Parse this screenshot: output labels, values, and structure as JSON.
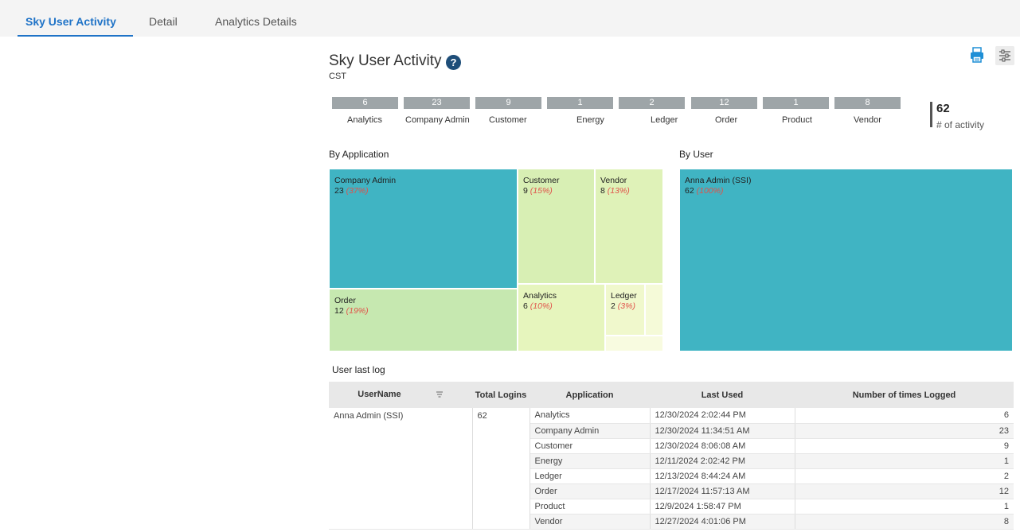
{
  "tabs": [
    {
      "label": "Sky User Activity",
      "active": true
    },
    {
      "label": "Detail",
      "active": false
    },
    {
      "label": "Analytics Details",
      "active": false
    }
  ],
  "page": {
    "title": "Sky User Activity",
    "help": "?",
    "subtitle": "CST"
  },
  "tools": {
    "print_icon": "printer-icon",
    "settings_icon": "sliders-icon"
  },
  "colors": {
    "accent": "#1f73c7",
    "teal": "#40b4c3",
    "green_light": "#c6e8b0",
    "yellow_green": "#e4f3b8",
    "yellow_pale": "#f3f9d5",
    "kpi_bar": "#9ea5a8",
    "pct_red": "#e0524a"
  },
  "kpis": [
    {
      "value": "6",
      "label": "Analytics"
    },
    {
      "value": "23",
      "label": "Company Admin"
    },
    {
      "value": "9",
      "label": "Customer"
    },
    {
      "value": "1",
      "label": "Energy"
    },
    {
      "value": "2",
      "label": "Ledger"
    },
    {
      "value": "12",
      "label": "Order"
    },
    {
      "value": "1",
      "label": "Product"
    },
    {
      "value": "8",
      "label": "Vendor"
    }
  ],
  "total": {
    "value": "62",
    "label": "# of activity"
  },
  "by_application": {
    "title": "By Application",
    "tiles": [
      {
        "name": "Company Admin",
        "value": "23",
        "pct": "(37%)"
      },
      {
        "name": "Customer",
        "value": "9",
        "pct": "(15%)"
      },
      {
        "name": "Vendor",
        "value": "8",
        "pct": "(13%)"
      },
      {
        "name": "Order",
        "value": "12",
        "pct": "(19%)"
      },
      {
        "name": "Analytics",
        "value": "6",
        "pct": "(10%)"
      },
      {
        "name": "Ledger",
        "value": "2",
        "pct": "(3%)"
      }
    ]
  },
  "by_user": {
    "title": "By User",
    "tiles": [
      {
        "name": "Anna Admin (SSI)",
        "value": "62",
        "pct": "(100%)"
      }
    ]
  },
  "log": {
    "title": "User last log",
    "headers": {
      "user": "UserName",
      "logins": "Total Logins",
      "app": "Application",
      "last": "Last Used",
      "count": "Number of times Logged"
    },
    "user": "Anna Admin (SSI)",
    "total_logins": "62",
    "rows": [
      {
        "app": "Analytics",
        "last": "12/30/2024 2:02:44 PM",
        "count": "6"
      },
      {
        "app": "Company Admin",
        "last": "12/30/2024 11:34:51 AM",
        "count": "23"
      },
      {
        "app": "Customer",
        "last": "12/30/2024 8:06:08 AM",
        "count": "9"
      },
      {
        "app": "Energy",
        "last": "12/11/2024 2:02:42 PM",
        "count": "1"
      },
      {
        "app": "Ledger",
        "last": "12/13/2024 8:44:24 AM",
        "count": "2"
      },
      {
        "app": "Order",
        "last": "12/17/2024 11:57:13 AM",
        "count": "12"
      },
      {
        "app": "Product",
        "last": "12/9/2024 1:58:47 PM",
        "count": "1"
      },
      {
        "app": "Vendor",
        "last": "12/27/2024 4:01:06 PM",
        "count": "8"
      }
    ]
  }
}
